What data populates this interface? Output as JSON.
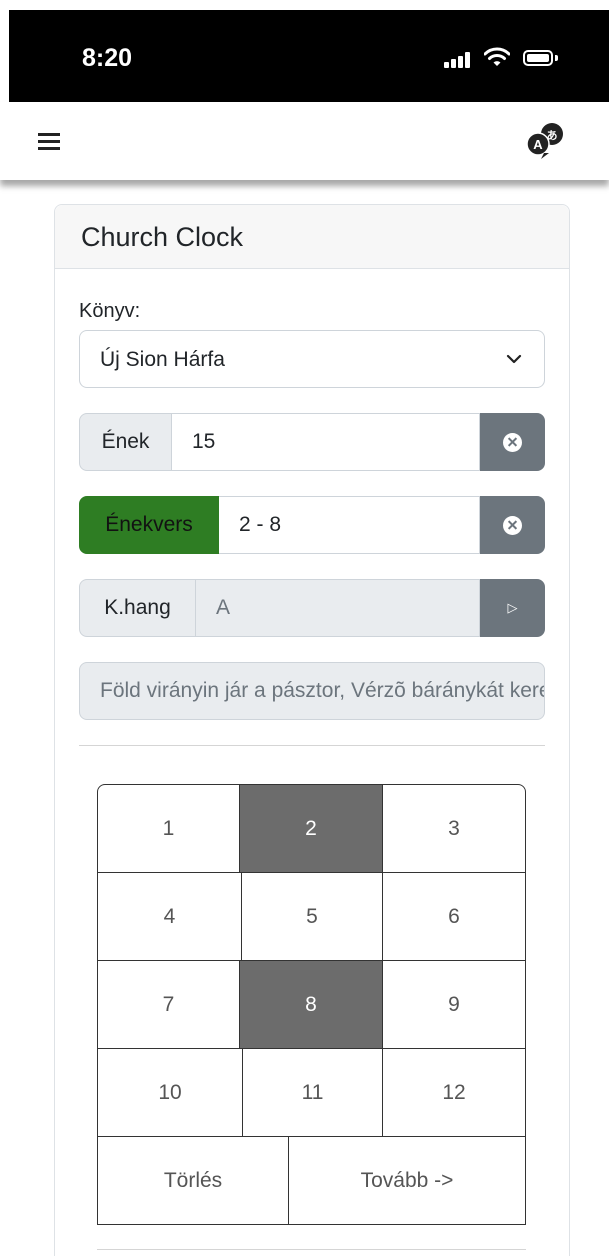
{
  "status": {
    "time": "8:20"
  },
  "icons": {
    "menu": "hamburger-icon",
    "language": "translate-icon",
    "signal": "cellular-signal-icon",
    "wifi": "wifi-icon",
    "battery": "battery-icon"
  },
  "card": {
    "title": "Church Clock"
  },
  "form": {
    "book_label": "Könyv:",
    "book_value": "Új Sion Hárfa",
    "song_label": "Ének",
    "song_value": "15",
    "verses_label": "Énekvers",
    "verses_value": "2 - 8",
    "key_label": "K.hang",
    "key_value": "A",
    "title_value": "Föld virányin jár a pásztor, Vérzõ báránykát keres"
  },
  "colors": {
    "accent_green": "#2e7d23",
    "button_gray": "#6c757d",
    "selected_cell": "#6c6c6c"
  },
  "verse_grid": {
    "cells": [
      "1",
      "2",
      "3",
      "4",
      "5",
      "6",
      "7",
      "8",
      "9",
      "10",
      "11",
      "12"
    ],
    "selected": [
      "2",
      "8"
    ],
    "clear_label": "Törlés",
    "next_label": "Tovább ->"
  }
}
